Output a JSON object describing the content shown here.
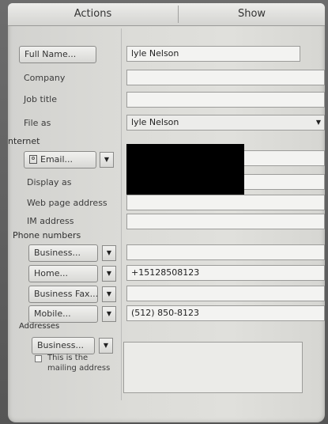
{
  "ribbon": {
    "tabs": [
      {
        "label": "Actions"
      },
      {
        "label": "Show"
      }
    ]
  },
  "name_section": {
    "full_name_button": "Full Name...",
    "full_name_value": "lyle Nelson",
    "company_label": "Company",
    "company_value": "",
    "job_title_label": "Job title",
    "job_title_value": "",
    "file_as_label": "File as",
    "file_as_value": "lyle Nelson"
  },
  "internet_section": {
    "heading": "nternet",
    "email_button": "Email...",
    "email_value": "",
    "display_as_label": "Display as",
    "web_page_label": "Web page address",
    "web_page_value": "",
    "im_address_label": "IM address",
    "im_address_value": ""
  },
  "phone_section": {
    "heading": "Phone numbers",
    "phones": [
      {
        "type": "Business...",
        "value": ""
      },
      {
        "type": "Home...",
        "value": "+15128508123"
      },
      {
        "type": "Business Fax...",
        "value": ""
      },
      {
        "type": "Mobile...",
        "value": "(512) 850-8123"
      }
    ]
  },
  "address_section": {
    "heading": "Addresses",
    "type": "Business...",
    "mailing_checkbox_label_line1": "This is the",
    "mailing_checkbox_label_line2": "mailing address",
    "mailing_checked": false,
    "address_value": ""
  },
  "icons": {
    "dropdown_arrow": "chevron-down-icon",
    "email_contact": "contact-card-icon"
  },
  "colors": {
    "background": "#5e5e5e",
    "panel": "#dcdcd8",
    "redaction": "#000000"
  }
}
